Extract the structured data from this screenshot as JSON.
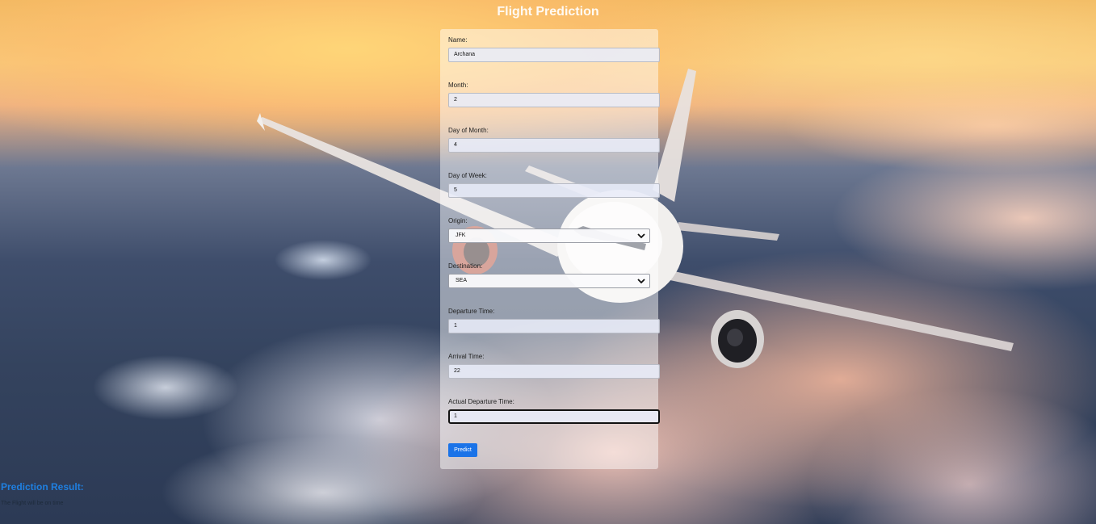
{
  "title": "Flight Prediction",
  "form": {
    "name": {
      "label": "Name:",
      "value": "Archana"
    },
    "month": {
      "label": "Month:",
      "value": "2"
    },
    "day_of_month": {
      "label": "Day of Month:",
      "value": "4"
    },
    "day_of_week": {
      "label": "Day of Week:",
      "value": "5"
    },
    "origin": {
      "label": "Origin:",
      "value": "JFK"
    },
    "destination": {
      "label": "Destination:",
      "value": "SEA"
    },
    "departure_time": {
      "label": "Departure Time:",
      "value": "1"
    },
    "arrival_time": {
      "label": "Arrival Time:",
      "value": "22"
    },
    "actual_departure_time": {
      "label": "Actual Departure Time:",
      "value": "1"
    },
    "submit_label": "Predict"
  },
  "result": {
    "heading": "Prediction Result:",
    "text": "The Flight will be on time"
  },
  "colors": {
    "button": "#1a73e8",
    "result_heading": "#1f7fe0"
  },
  "icons": {
    "select_arrow": "chevron-down-icon"
  }
}
